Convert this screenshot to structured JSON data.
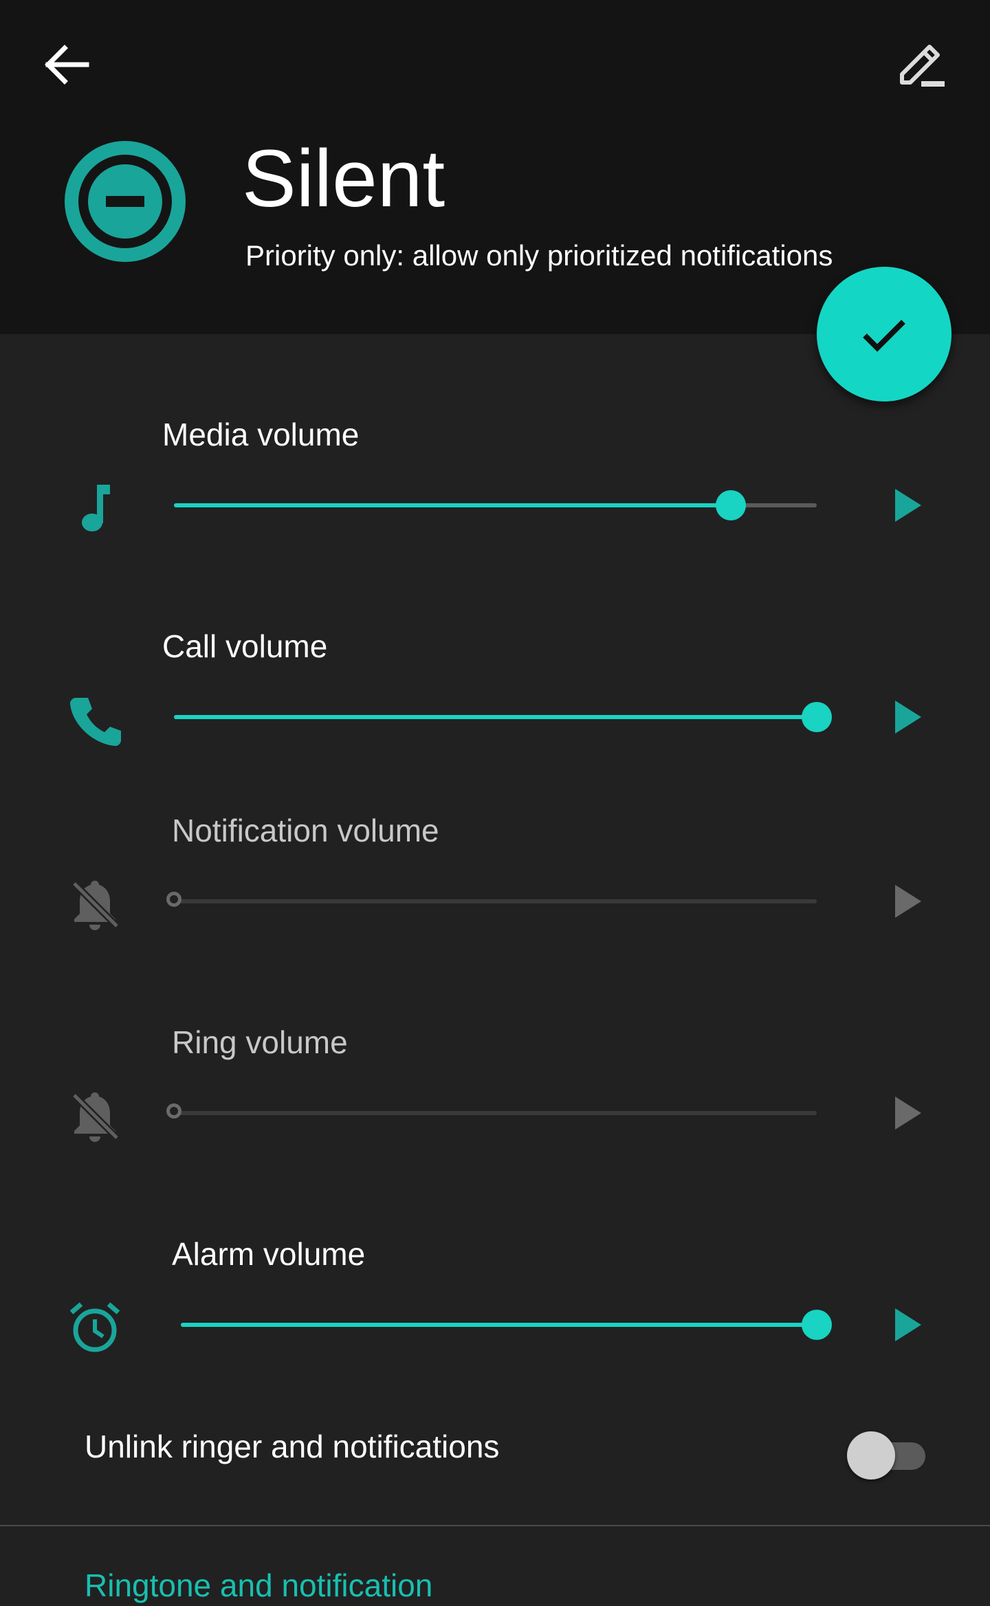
{
  "header": {
    "back_icon": "arrow-back-icon",
    "edit_icon": "edit-pencil-icon",
    "profile_icon": "do-not-disturb-icon",
    "title": "Silent",
    "subtitle": "Priority only: allow only prioritized notifications",
    "fab_icon": "check-icon"
  },
  "volumes": [
    {
      "label": "Media volume",
      "icon": "music-note-icon",
      "level": 0.866,
      "enabled": true
    },
    {
      "label": "Call volume",
      "icon": "phone-icon",
      "level": 1.0,
      "enabled": true
    },
    {
      "label": "Notification volume",
      "icon": "notifications-off-icon",
      "level": 0.0,
      "enabled": false
    },
    {
      "label": "Ring volume",
      "icon": "notifications-off-icon",
      "level": 0.0,
      "enabled": false
    },
    {
      "label": "Alarm volume",
      "icon": "alarm-icon",
      "level": 1.0,
      "enabled": true
    }
  ],
  "unlink": {
    "label": "Unlink ringer and notifications",
    "checked": false
  },
  "next_section": {
    "label": "Ringtone and notification"
  },
  "colors": {
    "accent": "#19d3c3",
    "background": "#212121",
    "header_background": "#141414"
  }
}
